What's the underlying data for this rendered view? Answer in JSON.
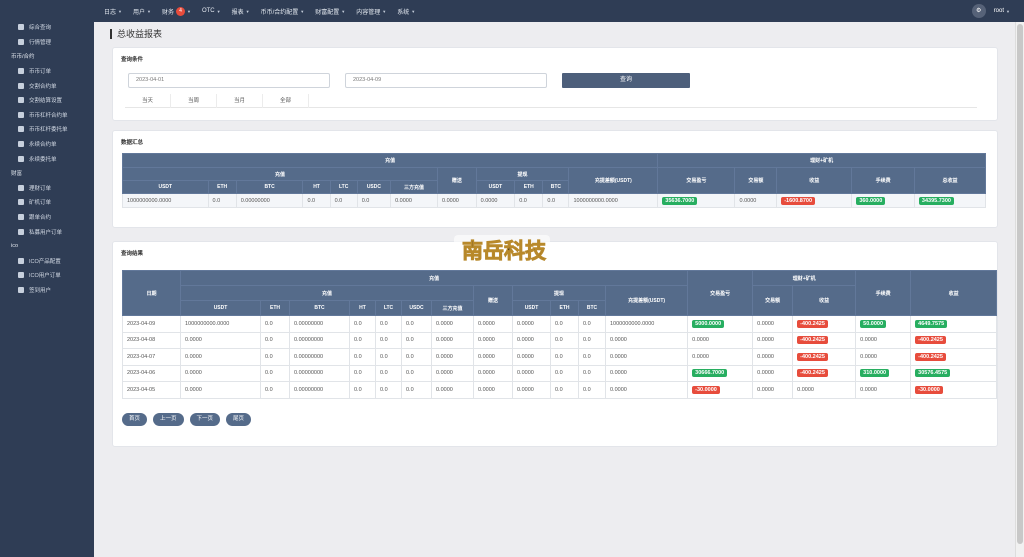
{
  "topnav": {
    "items": [
      {
        "label": "日志",
        "caret": true
      },
      {
        "label": "用户",
        "caret": true
      },
      {
        "label": "财务",
        "caret": true,
        "badge": "4"
      },
      {
        "label": "OTC",
        "caret": true
      },
      {
        "label": "报表",
        "caret": true
      },
      {
        "label": "币币/合约配置",
        "caret": true
      },
      {
        "label": "财富配置",
        "caret": true
      },
      {
        "label": "内容管理",
        "caret": true
      },
      {
        "label": "系统",
        "caret": true
      }
    ],
    "user": "root",
    "avatar_icon": "user-avatar-icon"
  },
  "sidebar": {
    "entries": [
      {
        "type": "item",
        "label": "综合查询",
        "icon": "grid-icon"
      },
      {
        "type": "item",
        "label": "行情管理",
        "icon": "chart-icon"
      },
      {
        "type": "group",
        "label": "币币/合约"
      },
      {
        "type": "item",
        "label": "币币订单",
        "icon": "bookmark-icon"
      },
      {
        "type": "item",
        "label": "交割合约单",
        "icon": "bookmark-icon"
      },
      {
        "type": "item",
        "label": "交割结算设置",
        "icon": "document-icon"
      },
      {
        "type": "item",
        "label": "币币杠杆合约单",
        "icon": "document-icon"
      },
      {
        "type": "item",
        "label": "币币杠杆委托单",
        "icon": "list-icon"
      },
      {
        "type": "item",
        "label": "永续合约单",
        "icon": "document-icon"
      },
      {
        "type": "item",
        "label": "永续委托单",
        "icon": "list-icon"
      },
      {
        "type": "group",
        "label": "财富"
      },
      {
        "type": "item",
        "label": "理财订单",
        "icon": "box-icon"
      },
      {
        "type": "item",
        "label": "矿机订单",
        "icon": "cog-icon"
      },
      {
        "type": "item",
        "label": "跟单合约",
        "icon": "document-icon"
      },
      {
        "type": "item",
        "label": "私募用户订单",
        "icon": "dollar-icon"
      },
      {
        "type": "group",
        "label": "ico"
      },
      {
        "type": "item",
        "label": "ICO产品配置",
        "icon": "document-icon"
      },
      {
        "type": "item",
        "label": "ICO用户订单",
        "icon": "monitor-icon"
      },
      {
        "type": "item",
        "label": "签到用户",
        "icon": "list-icon"
      }
    ]
  },
  "page": {
    "title": "总收益报表"
  },
  "query": {
    "title": "查询条件",
    "start_date": "2023-04-01",
    "end_date": "2023-04-09",
    "submit_label": "查询",
    "quick_tabs": [
      "当天",
      "当周",
      "当月",
      "全部"
    ]
  },
  "summary": {
    "title": "数据汇总",
    "group_headers": {
      "recharge": "充值",
      "recharge_sub": "充值",
      "withdraw": "提现",
      "finance": "理财+矿机"
    },
    "headers": [
      "USDT",
      "ETH",
      "BTC",
      "HT",
      "LTC",
      "USDC",
      "三方充值",
      "赠送",
      "USDT",
      "ETH",
      "BTC",
      "充提差额(USDT)",
      "交易盈亏",
      "交易额",
      "收益",
      "手续费",
      "总收益"
    ],
    "row": [
      {
        "v": "1000000000.0000"
      },
      {
        "v": "0.0"
      },
      {
        "v": "0.00000000"
      },
      {
        "v": "0.0"
      },
      {
        "v": "0.0"
      },
      {
        "v": "0.0"
      },
      {
        "v": "0.0000"
      },
      {
        "v": "0.0000"
      },
      {
        "v": "0.0000"
      },
      {
        "v": "0.0"
      },
      {
        "v": "0.0"
      },
      {
        "v": "1000000000.0000"
      },
      {
        "v": "35636.7000",
        "pill": "green"
      },
      {
        "v": "0.0000"
      },
      {
        "v": "-1600.8700",
        "pill": "red"
      },
      {
        "v": "360.0000",
        "pill": "green"
      },
      {
        "v": "34395.7300",
        "pill": "green"
      }
    ]
  },
  "results": {
    "title": "查询结果",
    "group_headers": {
      "date": "日期",
      "recharge": "充值",
      "recharge_sub": "充值",
      "gift": "赠送",
      "withdraw": "提现",
      "diff": "充提差额(USDT)",
      "trade_pl": "交易盈亏",
      "finance": "理财+矿机",
      "fee": "手续费",
      "profit": "收益"
    },
    "headers": [
      "USDT",
      "ETH",
      "BTC",
      "HT",
      "LTC",
      "USDC",
      "三方充值",
      "USDT",
      "ETH",
      "BTC",
      "交易额",
      "收益"
    ],
    "rows": [
      [
        {
          "v": "2023-04-09"
        },
        {
          "v": "1000000000.0000"
        },
        {
          "v": "0.0"
        },
        {
          "v": "0.00000000"
        },
        {
          "v": "0.0"
        },
        {
          "v": "0.0"
        },
        {
          "v": "0.0"
        },
        {
          "v": "0.0000"
        },
        {
          "v": "0.0000"
        },
        {
          "v": "0.0000"
        },
        {
          "v": "0.0"
        },
        {
          "v": "0.0"
        },
        {
          "v": "1000000000.0000"
        },
        {
          "v": "5000.0000",
          "pill": "green"
        },
        {
          "v": "0.0000"
        },
        {
          "v": "-400.2425",
          "pill": "red"
        },
        {
          "v": "50.0000",
          "pill": "green"
        },
        {
          "v": "4649.7575",
          "pill": "green"
        }
      ],
      [
        {
          "v": "2023-04-08"
        },
        {
          "v": "0.0000"
        },
        {
          "v": "0.0"
        },
        {
          "v": "0.00000000"
        },
        {
          "v": "0.0"
        },
        {
          "v": "0.0"
        },
        {
          "v": "0.0"
        },
        {
          "v": "0.0000"
        },
        {
          "v": "0.0000"
        },
        {
          "v": "0.0000"
        },
        {
          "v": "0.0"
        },
        {
          "v": "0.0"
        },
        {
          "v": "0.0000"
        },
        {
          "v": "0.0000"
        },
        {
          "v": "0.0000"
        },
        {
          "v": "-400.2425",
          "pill": "red"
        },
        {
          "v": "0.0000"
        },
        {
          "v": "-400.2425",
          "pill": "red"
        }
      ],
      [
        {
          "v": "2023-04-07"
        },
        {
          "v": "0.0000"
        },
        {
          "v": "0.0"
        },
        {
          "v": "0.00000000"
        },
        {
          "v": "0.0"
        },
        {
          "v": "0.0"
        },
        {
          "v": "0.0"
        },
        {
          "v": "0.0000"
        },
        {
          "v": "0.0000"
        },
        {
          "v": "0.0000"
        },
        {
          "v": "0.0"
        },
        {
          "v": "0.0"
        },
        {
          "v": "0.0000"
        },
        {
          "v": "0.0000"
        },
        {
          "v": "0.0000"
        },
        {
          "v": "-400.2425",
          "pill": "red"
        },
        {
          "v": "0.0000"
        },
        {
          "v": "-400.2425",
          "pill": "red"
        }
      ],
      [
        {
          "v": "2023-04-06"
        },
        {
          "v": "0.0000"
        },
        {
          "v": "0.0"
        },
        {
          "v": "0.00000000"
        },
        {
          "v": "0.0"
        },
        {
          "v": "0.0"
        },
        {
          "v": "0.0"
        },
        {
          "v": "0.0000"
        },
        {
          "v": "0.0000"
        },
        {
          "v": "0.0000"
        },
        {
          "v": "0.0"
        },
        {
          "v": "0.0"
        },
        {
          "v": "0.0000"
        },
        {
          "v": "30666.7000",
          "pill": "green"
        },
        {
          "v": "0.0000"
        },
        {
          "v": "-400.2425",
          "pill": "red"
        },
        {
          "v": "310.0000",
          "pill": "green"
        },
        {
          "v": "30576.4575",
          "pill": "green"
        }
      ],
      [
        {
          "v": "2023-04-05"
        },
        {
          "v": "0.0000"
        },
        {
          "v": "0.0"
        },
        {
          "v": "0.00000000"
        },
        {
          "v": "0.0"
        },
        {
          "v": "0.0"
        },
        {
          "v": "0.0"
        },
        {
          "v": "0.0000"
        },
        {
          "v": "0.0000"
        },
        {
          "v": "0.0000"
        },
        {
          "v": "0.0"
        },
        {
          "v": "0.0"
        },
        {
          "v": "0.0000"
        },
        {
          "v": "-30.0000",
          "pill": "red"
        },
        {
          "v": "0.0000"
        },
        {
          "v": "0.0000"
        },
        {
          "v": "0.0000"
        },
        {
          "v": "-30.0000",
          "pill": "red"
        }
      ]
    ],
    "pager": [
      "首页",
      "上一页",
      "下一页",
      "尾页"
    ]
  },
  "watermark": {
    "text": "南岳科技",
    "color": "#1a1a1a",
    "accent": "#b8892b"
  },
  "colors": {
    "nav_bg": "#2f3d55",
    "table_header": "#556b8a",
    "positive": "#27ae60",
    "negative": "#e74c3c"
  }
}
